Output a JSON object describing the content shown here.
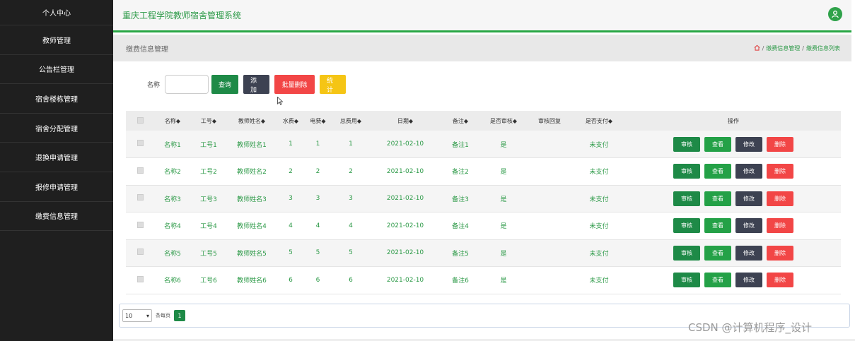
{
  "sidebar": {
    "items": [
      {
        "label": "个人中心"
      },
      {
        "label": "教师管理"
      },
      {
        "label": "公告栏管理"
      },
      {
        "label": "宿舍楼栋管理"
      },
      {
        "label": "宿舍分配管理"
      },
      {
        "label": "退换申请管理"
      },
      {
        "label": "报修申请管理"
      },
      {
        "label": "缴费信息管理"
      }
    ]
  },
  "header": {
    "title": "重庆工程学院教师宿舍管理系统",
    "avatar_icon": "user-icon"
  },
  "crumb": {
    "page_title": "缴费信息管理",
    "home_icon": "home-icon",
    "sep": "/",
    "level1": "缴费信息管理",
    "level2": "缴费信息列表"
  },
  "search": {
    "label": "名称",
    "input_value": "",
    "query": "查询",
    "add": "添加",
    "batch_delete": "批量删除",
    "stats": "统计"
  },
  "table": {
    "headers": [
      "名称◆",
      "工号◆",
      "教师姓名◆",
      "水费◆",
      "电费◆",
      "总费用◆",
      "日期◆",
      "备注◆",
      "是否审核◆",
      "审核回复",
      "是否支付◆",
      "操作"
    ],
    "rows": [
      {
        "name": "名称1",
        "id": "工号1",
        "teacher": "教师姓名1",
        "water": "1",
        "elec": "1",
        "total": "1",
        "date": "2021-02-10",
        "note": "备注1",
        "audited": "是",
        "reply": "",
        "paid": "未支付"
      },
      {
        "name": "名称2",
        "id": "工号2",
        "teacher": "教师姓名2",
        "water": "2",
        "elec": "2",
        "total": "2",
        "date": "2021-02-10",
        "note": "备注2",
        "audited": "是",
        "reply": "",
        "paid": "未支付"
      },
      {
        "name": "名称3",
        "id": "工号3",
        "teacher": "教师姓名3",
        "water": "3",
        "elec": "3",
        "total": "3",
        "date": "2021-02-10",
        "note": "备注3",
        "audited": "是",
        "reply": "",
        "paid": "未支付"
      },
      {
        "name": "名称4",
        "id": "工号4",
        "teacher": "教师姓名4",
        "water": "4",
        "elec": "4",
        "total": "4",
        "date": "2021-02-10",
        "note": "备注4",
        "audited": "是",
        "reply": "",
        "paid": "未支付"
      },
      {
        "name": "名称5",
        "id": "工号5",
        "teacher": "教师姓名5",
        "water": "5",
        "elec": "5",
        "total": "5",
        "date": "2021-02-10",
        "note": "备注5",
        "audited": "是",
        "reply": "",
        "paid": "未支付"
      },
      {
        "name": "名称6",
        "id": "工号6",
        "teacher": "教师姓名6",
        "water": "6",
        "elec": "6",
        "total": "6",
        "date": "2021-02-10",
        "note": "备注6",
        "audited": "是",
        "reply": "",
        "paid": "未支付"
      }
    ],
    "actions": {
      "audit": "审核",
      "view": "查看",
      "edit": "修改",
      "delete": "删除"
    }
  },
  "pager": {
    "page_size": "10",
    "per_page_label": "条每页",
    "current_page": "1"
  },
  "watermark": "CSDN @计算机程序_设计"
}
